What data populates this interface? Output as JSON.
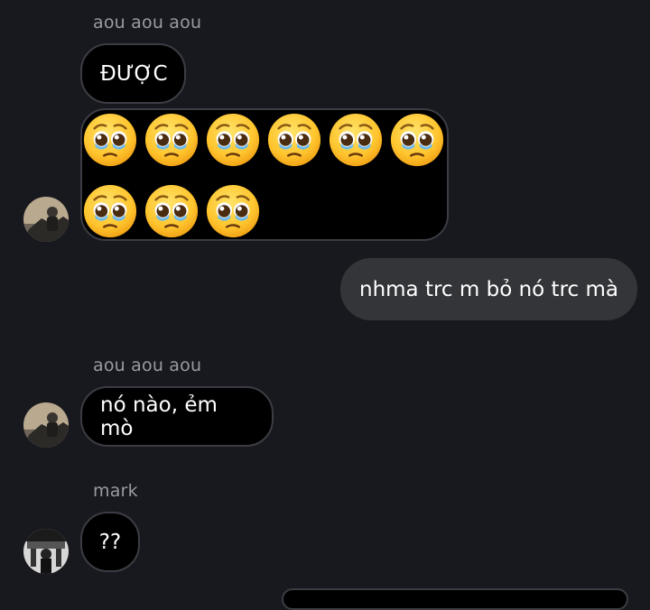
{
  "messages": [
    {
      "sender": "aou aou aou",
      "text": "ĐƯỢC"
    },
    {
      "emojis": [
        "pleading-face-with-tears",
        "pleading-face-with-tears",
        "pleading-face-with-tears",
        "pleading-face-with-tears",
        "pleading-face-with-tears",
        "pleading-face-with-tears",
        "pleading-face-with-tears",
        "pleading-face-with-tears",
        "pleading-face-with-tears"
      ]
    },
    {
      "sender": "me",
      "text": "nhma trc m bỏ nó trc mà"
    },
    {
      "sender": "aou aou aou",
      "text": "nó nào, ẻm mò"
    },
    {
      "sender": "mark",
      "text": "??"
    }
  ],
  "colors": {
    "background": "#18191e",
    "incoming_bubble": "#000000",
    "outgoing_bubble": "#343539",
    "sender_name": "#9a9ba3"
  }
}
